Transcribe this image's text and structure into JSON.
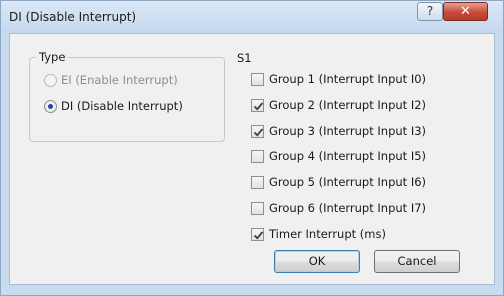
{
  "window": {
    "title": "DI (Disable Interrupt)",
    "help_glyph": "?",
    "close_glyph": "✕"
  },
  "type_group": {
    "label": "Type",
    "options": [
      {
        "label": "EI (Enable Interrupt)",
        "selected": false,
        "enabled": false
      },
      {
        "label": "DI (Disable Interrupt)",
        "selected": true,
        "enabled": true
      }
    ]
  },
  "s1": {
    "label": "S1",
    "items": [
      {
        "label": "Group 1 (Interrupt Input I0)",
        "checked": false
      },
      {
        "label": "Group 2 (Interrupt Input I2)",
        "checked": true
      },
      {
        "label": "Group 3 (Interrupt Input I3)",
        "checked": true
      },
      {
        "label": "Group 4 (Interrupt Input I5)",
        "checked": false
      },
      {
        "label": "Group 5 (Interrupt Input I6)",
        "checked": false
      },
      {
        "label": "Group 6 (Interrupt Input I7)",
        "checked": false
      },
      {
        "label": "Timer Interrupt (ms)",
        "checked": true
      }
    ]
  },
  "buttons": {
    "ok": "OK",
    "cancel": "Cancel"
  }
}
